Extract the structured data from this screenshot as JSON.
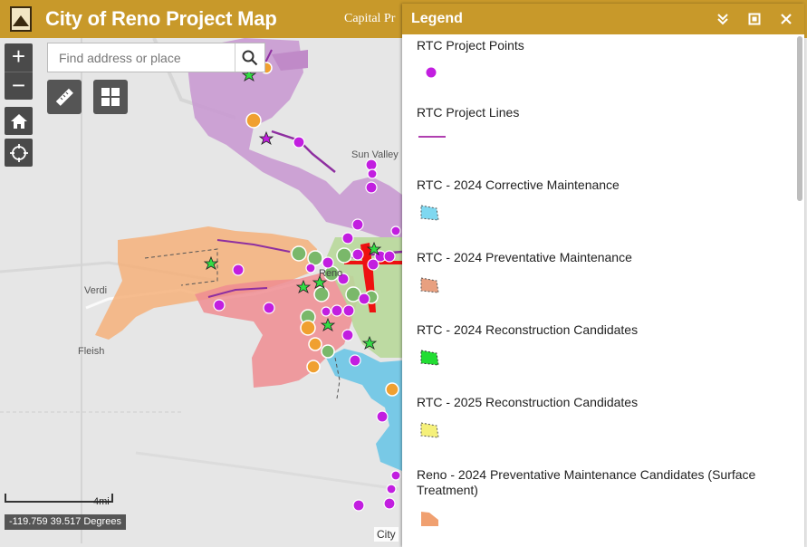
{
  "header": {
    "title": "City of Reno Project Map",
    "link_text": "Capital Pr"
  },
  "map": {
    "search_placeholder": "Find address or place",
    "zoom_in": "+",
    "zoom_out": "−",
    "scale_label": "4mi",
    "coordinates": "-119.759 39.517 Degrees",
    "attribution": "City",
    "place_labels": {
      "sun_valley": "Sun Valley",
      "verdi": "Verdi",
      "fleish": "Fleish",
      "reno": "Reno"
    }
  },
  "legend": {
    "title": "Legend",
    "items": [
      {
        "label": "RTC Project Points",
        "symbol": "magenta-point",
        "color": "#c21ee0"
      },
      {
        "label": "RTC Project Lines",
        "symbol": "purple-line",
        "color": "#b040b0"
      },
      {
        "label": "RTC - 2024 Corrective Maintenance",
        "symbol": "polygon",
        "color": "#7fd8f0"
      },
      {
        "label": "RTC - 2024 Preventative Maintenance",
        "symbol": "polygon",
        "color": "#e8a080"
      },
      {
        "label": "RTC - 2024 Reconstruction Candidates",
        "symbol": "polygon",
        "color": "#22dd33"
      },
      {
        "label": "RTC - 2025 Reconstruction Candidates",
        "symbol": "polygon",
        "color": "#f5f07a"
      },
      {
        "label": "Reno - 2024 Preventative Maintenance Candidates (Surface Treatment)",
        "symbol": "polygon",
        "color": "#f0a070"
      }
    ]
  },
  "colors": {
    "header_bg": "#c8992a",
    "control_bg": "#4a4a4a"
  }
}
